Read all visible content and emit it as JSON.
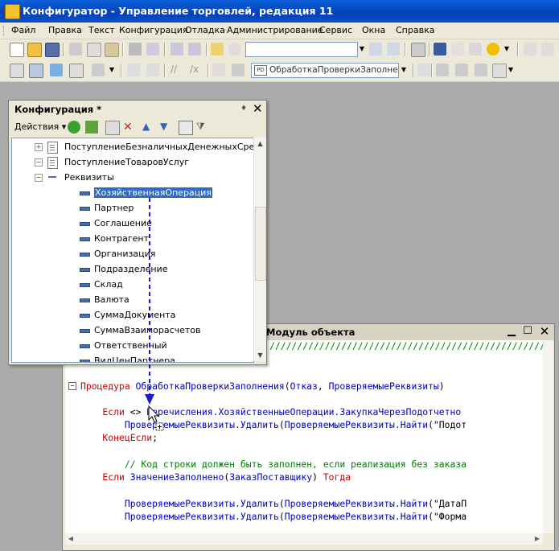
{
  "window": {
    "title": "Конфигуратор - Управление торговлей, редакция 11"
  },
  "menu": [
    "Файл",
    "Правка",
    "Текст",
    "Конфигурация",
    "Отладка",
    "Администрирование",
    "Сервис",
    "Окна",
    "Справка"
  ],
  "toolbar2": {
    "module_combo": "ОбработкаПроверкиЗаполнени",
    "module_combo_icon": "PD"
  },
  "config_panel": {
    "title": "Конфигурация *",
    "actions_label": "Действия",
    "tree": [
      {
        "label": "ПоступлениеБезналичныхДенежныхСредств",
        "level": 0,
        "type": "doc",
        "expander": "+"
      },
      {
        "label": "ПоступлениеТоваровУслуг",
        "level": 0,
        "type": "doc",
        "expander": "−"
      },
      {
        "label": "Реквизиты",
        "level": 1,
        "type": "group",
        "expander": "−"
      },
      {
        "label": "ХозяйственнаяОперация",
        "level": 2,
        "type": "attr",
        "selected": true
      },
      {
        "label": "Партнер",
        "level": 2,
        "type": "attr"
      },
      {
        "label": "Соглашение",
        "level": 2,
        "type": "attr"
      },
      {
        "label": "Контрагент",
        "level": 2,
        "type": "attr"
      },
      {
        "label": "Организация",
        "level": 2,
        "type": "attr"
      },
      {
        "label": "Подразделение",
        "level": 2,
        "type": "attr"
      },
      {
        "label": "Склад",
        "level": 2,
        "type": "attr"
      },
      {
        "label": "Валюта",
        "level": 2,
        "type": "attr"
      },
      {
        "label": "СуммаДокумента",
        "level": 2,
        "type": "attr"
      },
      {
        "label": "СуммаВзаиморасчетов",
        "level": 2,
        "type": "attr"
      },
      {
        "label": "Ответственный",
        "level": 2,
        "type": "attr"
      },
      {
        "label": "ВидЦенПартнера",
        "level": 2,
        "type": "attr"
      }
    ]
  },
  "module_window": {
    "title": "Модуль объекта",
    "lines": [
      [
        {
          "t": "cm",
          "v": "////////////////////////////////////////////////////////////////////"
        }
      ],
      [],
      [
        {
          "t": "kw",
          "v": "Процедура "
        },
        {
          "t": "id",
          "v": "ОбработкаПроверкиЗаполнения"
        },
        {
          "t": "tx",
          "v": "("
        },
        {
          "t": "id",
          "v": "Отказ"
        },
        {
          "t": "tx",
          "v": ", "
        },
        {
          "t": "id",
          "v": "ПроверяемыеРеквизиты"
        },
        {
          "t": "tx",
          "v": ")"
        }
      ],
      [],
      [
        {
          "t": "kw",
          "v": "    Если "
        },
        {
          "t": "tx",
          "v": "<> "
        },
        {
          "t": "id",
          "v": "Перечисления.ХозяйственныеОперации.ЗакупкаЧерезПодотчетно"
        }
      ],
      [
        {
          "t": "id",
          "v": "        ПроверяемыеРеквизиты.Удалить"
        },
        {
          "t": "tx",
          "v": "("
        },
        {
          "t": "id",
          "v": "ПроверяемыеРеквизиты.Найти"
        },
        {
          "t": "tx",
          "v": "(\"Подот"
        }
      ],
      [
        {
          "t": "kw",
          "v": "    КонецЕсли"
        },
        {
          "t": "tx",
          "v": ";"
        }
      ],
      [],
      [
        {
          "t": "cm",
          "v": "        // Код строки должен быть заполнен, если реализация без заказа"
        }
      ],
      [
        {
          "t": "kw",
          "v": "    Если "
        },
        {
          "t": "id",
          "v": "ЗначениеЗаполнено"
        },
        {
          "t": "tx",
          "v": "("
        },
        {
          "t": "id",
          "v": "ЗаказПоставщику"
        },
        {
          "t": "tx",
          "v": ") "
        },
        {
          "t": "kw",
          "v": "Тогда"
        }
      ],
      [],
      [
        {
          "t": "id",
          "v": "        ПроверяемыеРеквизиты.Удалить"
        },
        {
          "t": "tx",
          "v": "("
        },
        {
          "t": "id",
          "v": "ПроверяемыеРеквизиты.Найти"
        },
        {
          "t": "tx",
          "v": "(\"ДатаП"
        }
      ],
      [
        {
          "t": "id",
          "v": "        ПроверяемыеРеквизиты.Удалить"
        },
        {
          "t": "tx",
          "v": "("
        },
        {
          "t": "id",
          "v": "ПроверяемыеРеквизиты.Найти"
        },
        {
          "t": "tx",
          "v": "(\"Форма"
        }
      ]
    ]
  },
  "colors": {
    "titlebar": "#0a52cc",
    "selection": "#316ac5",
    "keyword": "#d00000",
    "identifier": "#0000c0",
    "comment": "#008000",
    "drag_line": "#1a1ad0"
  }
}
